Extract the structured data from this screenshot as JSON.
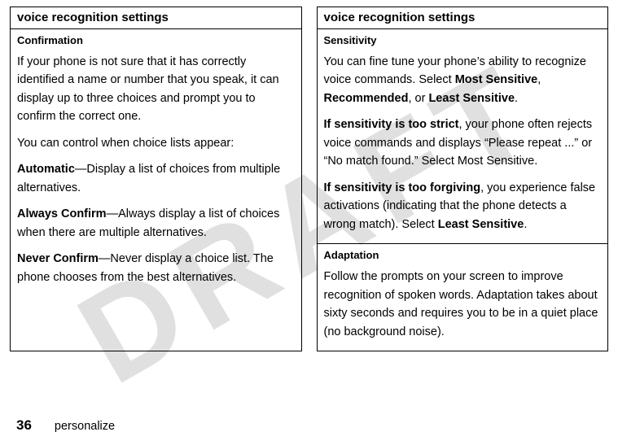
{
  "watermark": "DRAFT",
  "left": {
    "header": "voice recognition settings",
    "confirmation": {
      "heading": "Confirmation",
      "p1": "If your phone is not sure that it has correctly identified a name or number that you speak, it can display up to three choices and prompt you to confirm the correct one.",
      "p2": "You can control when choice lists appear:",
      "automatic_label": "Automatic",
      "automatic_text": "—Display a list of choices from multiple alternatives.",
      "always_label": "Always Confirm",
      "always_text": "—Always display a list of choices when there are multiple alternatives.",
      "never_label": "Never Confirm",
      "never_text": "—Never display a choice list. The phone chooses from the best alternatives."
    }
  },
  "right": {
    "header": "voice recognition settings",
    "sensitivity": {
      "heading": "Sensitivity",
      "intro_a": "You can fine tune your phone’s ability to recognize voice commands. Select ",
      "opt1": "Most Sensitive",
      "sep1": ", ",
      "opt2": "Recommended",
      "sep2": ", or ",
      "opt3": "Least Sensitive",
      "intro_end": ".",
      "strict_label": "If sensitivity is too strict",
      "strict_text": ", your phone often rejects voice commands and displays “Please repeat ...” or “No match found.” Select Most Sensitive.",
      "forgiving_label": "If sensitivity is too forgiving",
      "forgiving_text_a": ", you experience false activations (indicating that the phone detects a wrong match). Select ",
      "forgiving_opt": "Least Sensitive",
      "forgiving_text_b": "."
    },
    "adaptation": {
      "heading": "Adaptation",
      "p1": "Follow the prompts on your screen to improve recognition of spoken words. Adaptation takes about sixty seconds and requires you to be in a quiet place (no background noise)."
    }
  },
  "footer": {
    "page": "36",
    "label": "personalize"
  }
}
